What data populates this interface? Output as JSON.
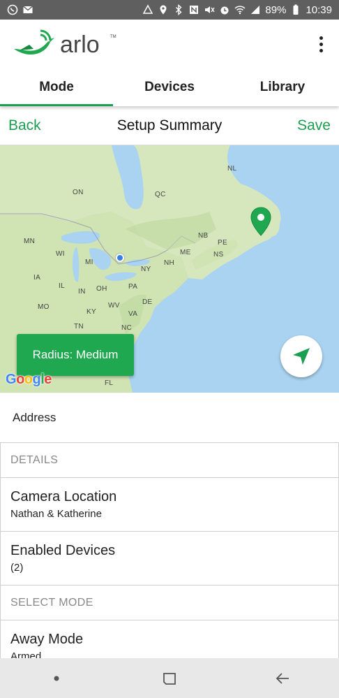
{
  "status_bar": {
    "battery": "89%",
    "time": "10:39"
  },
  "header": {
    "logo_text": "arlo",
    "logo_tm": "TM"
  },
  "tabs": [
    {
      "label": "Mode",
      "active": true
    },
    {
      "label": "Devices",
      "active": false
    },
    {
      "label": "Library",
      "active": false
    }
  ],
  "toolbar": {
    "back_label": "Back",
    "title": "Setup Summary",
    "save_label": "Save"
  },
  "map": {
    "radius_label": "Radius: Medium",
    "google_text": [
      "G",
      "o",
      "o",
      "g",
      "l",
      "e"
    ],
    "labels": [
      "ON",
      "QC",
      "NL",
      "MN",
      "WI",
      "MI",
      "NB",
      "PE",
      "ME",
      "NS",
      "NY",
      "NH",
      "IA",
      "IL",
      "IN",
      "OH",
      "PA",
      "MO",
      "KY",
      "WV",
      "DE",
      "VA",
      "TN",
      "NC",
      "FL"
    ]
  },
  "list": {
    "address_label": "Address",
    "details_header": "DETAILS",
    "camera_location_title": "Camera Location",
    "camera_location_value": "Nathan & Katherine",
    "enabled_devices_title": "Enabled Devices",
    "enabled_devices_value": "(2)",
    "select_mode_header": "SELECT MODE",
    "away_mode_title": "Away Mode",
    "away_mode_value": "Armed"
  },
  "colors": {
    "accent": "#1a9e4f",
    "status_bar": "#5f5f5f",
    "map_water": "#a9d3f0",
    "map_land": "#cfe3b3"
  },
  "icons": {
    "status_left": [
      "whatsapp-icon",
      "mail-icon"
    ],
    "status_right": [
      "data-saver-icon",
      "location-icon",
      "bluetooth-icon",
      "nfc-icon",
      "mute-icon",
      "alarm-icon",
      "wifi-icon",
      "signal-icon",
      "battery-icon"
    ],
    "locate": "navigation-arrow-icon",
    "nav": [
      "recent-apps-dot-icon",
      "home-square-icon",
      "back-arrow-icon"
    ]
  }
}
